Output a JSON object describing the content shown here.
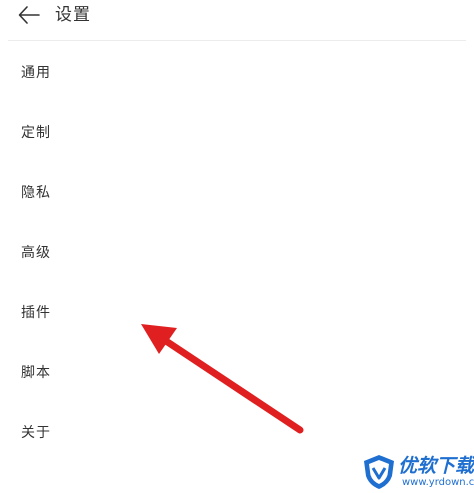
{
  "header": {
    "title": "设置",
    "back_icon": "back-arrow-icon"
  },
  "menu": {
    "items": [
      {
        "label": "通用"
      },
      {
        "label": "定制"
      },
      {
        "label": "隐私"
      },
      {
        "label": "高级"
      },
      {
        "label": "插件"
      },
      {
        "label": "脚本"
      },
      {
        "label": "关于"
      }
    ]
  },
  "annotation": {
    "arrow_color": "#e02020",
    "arrow_icon": "annotation-arrow-icon"
  },
  "watermark": {
    "name": "优软下载",
    "url": "www.yrdown.com",
    "color": "#1f6fd1"
  }
}
